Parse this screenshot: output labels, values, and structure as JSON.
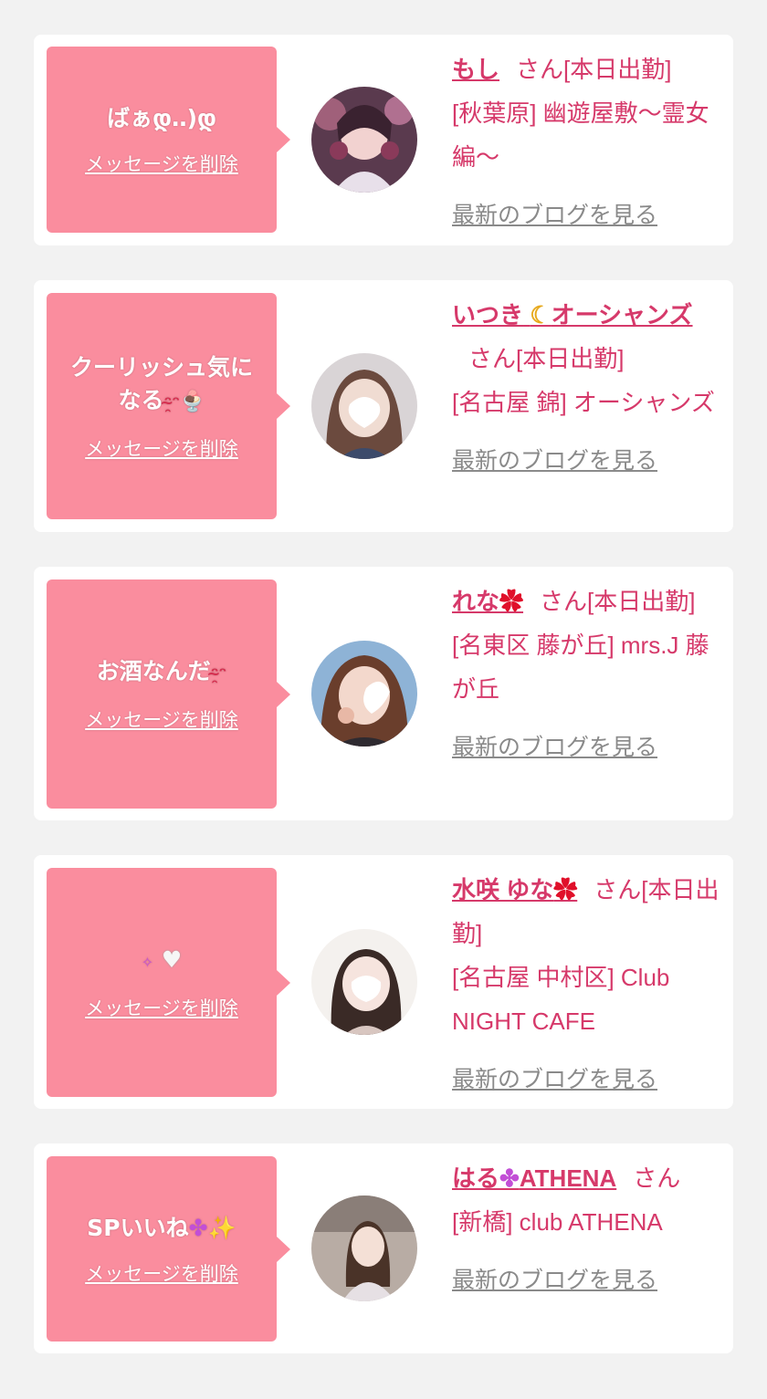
{
  "entries": [
    {
      "message": "ばぁდ‥)დ",
      "delete_label": "メッセージを削除",
      "name": "もし",
      "honorific": "さん[本日出勤]",
      "shop": "[秋葉原] 幽遊屋敷〜霊女編〜",
      "blog_label": "最新のブログを見る"
    },
    {
      "message": "クーリッシュ気になる",
      "delete_label": "メッセージを削除",
      "name": "いつき",
      "name_suffix": "オーシャンズ",
      "honorific": "さん[本日出勤]",
      "shop": "[名古屋 錦] オーシャンズ",
      "blog_label": "最新のブログを見る"
    },
    {
      "message": "お酒なんだ",
      "delete_label": "メッセージを削除",
      "name": "れな",
      "honorific": "さん[本日出勤]",
      "shop": "[名東区 藤が丘] mrs.J 藤が丘",
      "blog_label": "最新のブログを見る"
    },
    {
      "message": "",
      "delete_label": "メッセージを削除",
      "name": "水咲 ゆな",
      "honorific": "さん[本日出勤]",
      "shop": "[名古屋 中村区] Club NIGHT CAFE",
      "blog_label": "最新のブログを見る"
    },
    {
      "message": "SPいいね",
      "delete_label": "メッセージを削除",
      "name": "はる",
      "name_suffix": "ATHENA",
      "honorific": "さん",
      "shop": "[新橋] club ATHENA",
      "blog_label": "最新のブログを見る"
    }
  ],
  "colors": {
    "bubble": "#fa8d9e",
    "accent": "#d6396a",
    "link_gray": "#8a8a8a",
    "background": "#f2f2f2"
  },
  "icons": [
    "flower-icon",
    "moon-icon",
    "clover-icon",
    "sparkle-icon",
    "heart-icon",
    "steam-face-icon",
    "ice-cream-icon"
  ]
}
